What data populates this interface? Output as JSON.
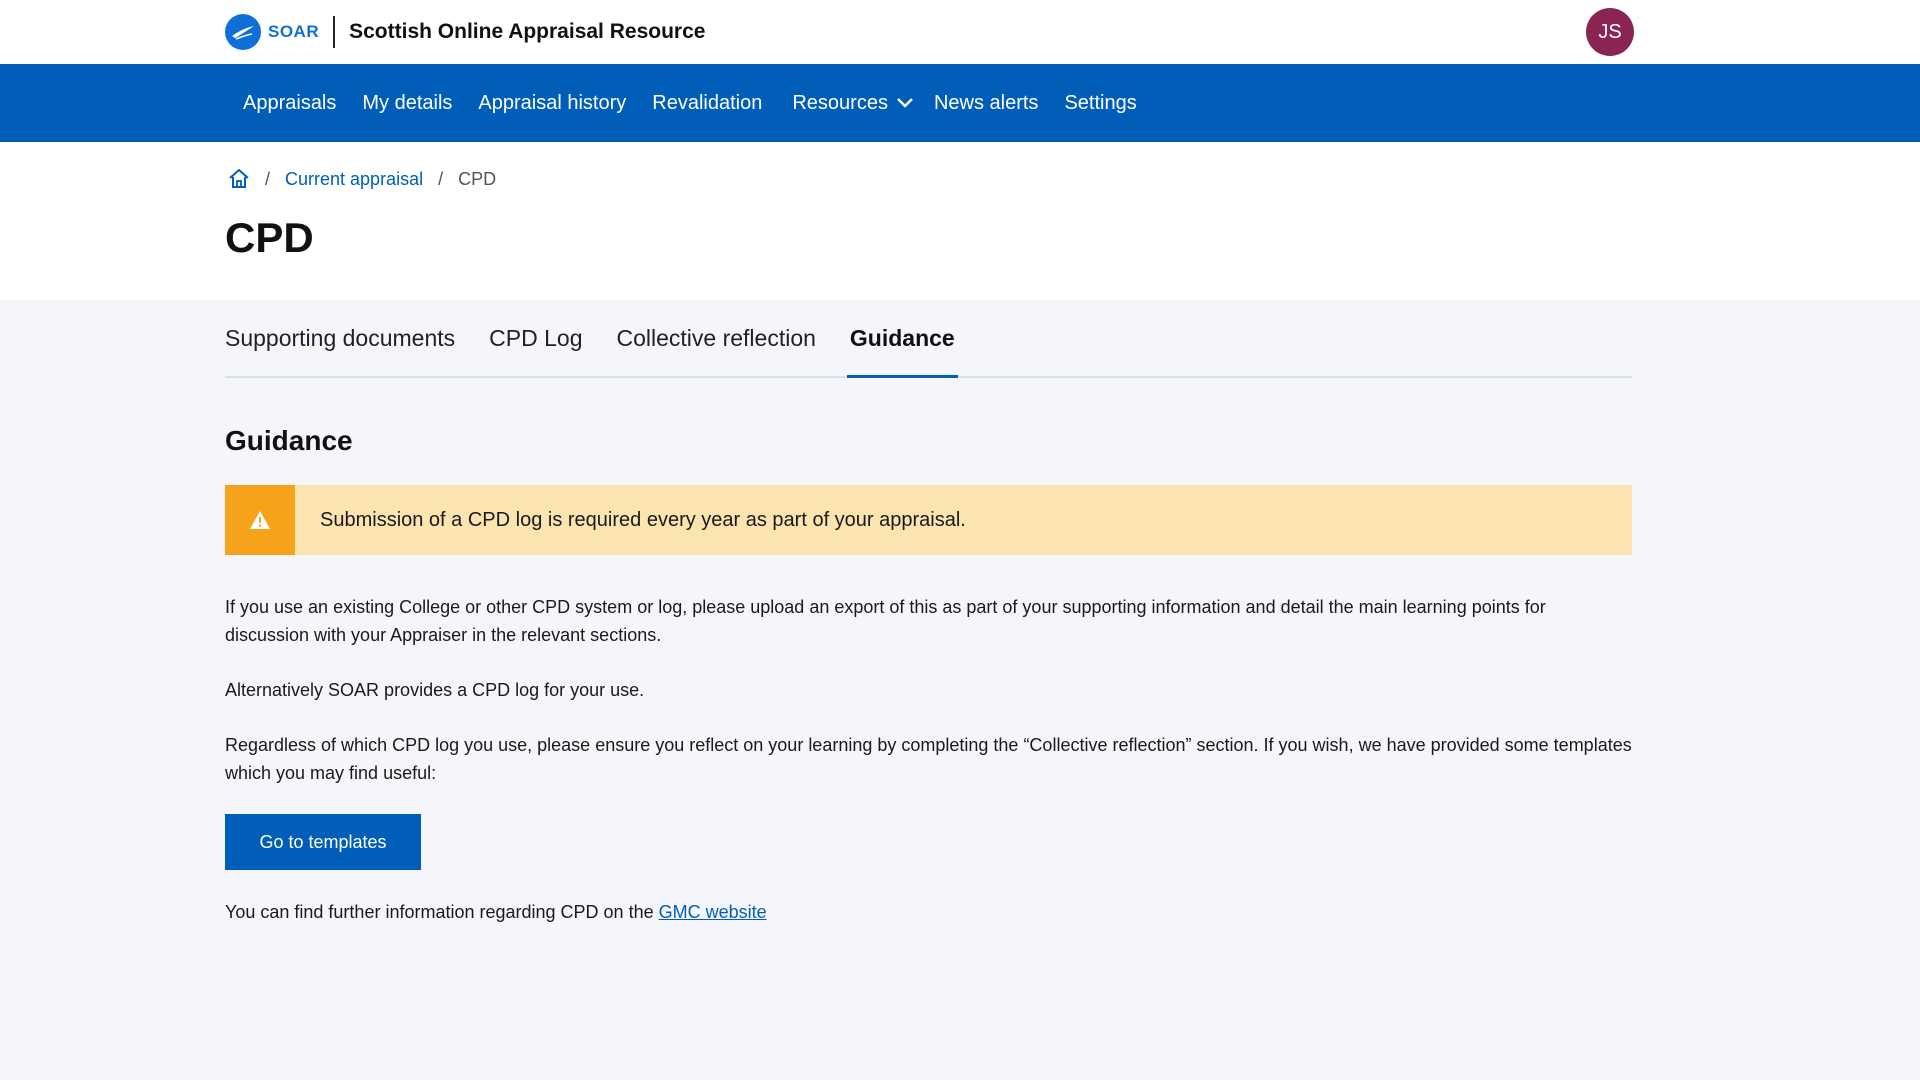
{
  "header": {
    "logo_word": "SOAR",
    "app_title": "Scottish Online Appraisal Resource",
    "avatar_initials": "JS",
    "avatar_color": "#8a2454"
  },
  "nav": {
    "items": [
      {
        "label": "Appraisals"
      },
      {
        "label": "My details"
      },
      {
        "label": "Appraisal history"
      },
      {
        "label": "Revalidation"
      },
      {
        "label": "Resources",
        "has_dropdown": true
      },
      {
        "label": "News alerts"
      },
      {
        "label": "Settings"
      }
    ]
  },
  "breadcrumb": {
    "home_icon": "home-icon",
    "items": [
      "Current appraisal",
      "CPD"
    ]
  },
  "page": {
    "title": "CPD"
  },
  "tabs": [
    {
      "label": "Supporting documents",
      "active": false
    },
    {
      "label": "CPD Log",
      "active": false
    },
    {
      "label": "Collective reflection",
      "active": false
    },
    {
      "label": "Guidance",
      "active": true
    }
  ],
  "guidance": {
    "heading": "Guidance",
    "alert": {
      "icon": "warning-icon",
      "text": "Submission of a CPD log is required every year as part of your appraisal."
    },
    "paragraphs": [
      "If you use an existing College or other CPD system or log, please upload an export of this as part of your supporting information and detail the main learning points for discussion with your Appraiser in the relevant sections.",
      "Alternatively SOAR provides a CPD log for your use.",
      "Regardless of which CPD log you use, please ensure you reflect on your learning by completing the “Collective reflection” section.  If you wish, we have provided some templates which you may find useful:"
    ],
    "button_label": "Go to templates",
    "footer_text": "You can find further information regarding CPD on the ",
    "footer_link": "GMC website"
  },
  "colors": {
    "brand_blue": "#005eb8",
    "alert_bg": "#fbe4b0",
    "alert_icon_bg": "#f7a21b"
  }
}
